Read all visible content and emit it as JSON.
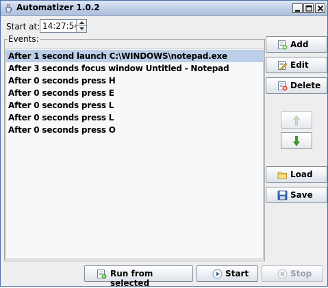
{
  "window": {
    "title": "Automatizer 1.0.2"
  },
  "start": {
    "label": "Start at:",
    "value": "14:27:54"
  },
  "events": {
    "legend": "Events:",
    "items": [
      {
        "text": "After 1 second launch C:\\WINDOWS\\notepad.exe",
        "selected": true
      },
      {
        "text": "After 3 seconds focus window Untitled - Notepad",
        "selected": false
      },
      {
        "text": "After 0 seconds press H",
        "selected": false
      },
      {
        "text": "After 0 seconds press E",
        "selected": false
      },
      {
        "text": "After 0 seconds press L",
        "selected": false
      },
      {
        "text": "After 0 seconds press L",
        "selected": false
      },
      {
        "text": "After 0 seconds press O",
        "selected": false
      }
    ]
  },
  "side_buttons": {
    "add": "Add",
    "edit": "Edit",
    "delete": "Delete",
    "load": "Load",
    "save": "Save"
  },
  "bottom_buttons": {
    "run_from_selected": "Run from selected",
    "start": "Start",
    "stop": "Stop"
  },
  "icons": {
    "app": "java-cup-icon",
    "add": "add-document-icon",
    "edit": "edit-document-icon",
    "delete": "delete-document-icon",
    "move_up": "arrow-up-icon",
    "move_down": "arrow-down-icon",
    "load": "folder-icon",
    "save": "floppy-disk-icon",
    "run": "run-document-icon",
    "start": "play-icon",
    "stop": "stop-icon"
  },
  "colors": {
    "selection": "#bccfe8",
    "arrow_up_disabled": "#c9dcc0",
    "arrow_down": "#3c9a2a"
  }
}
